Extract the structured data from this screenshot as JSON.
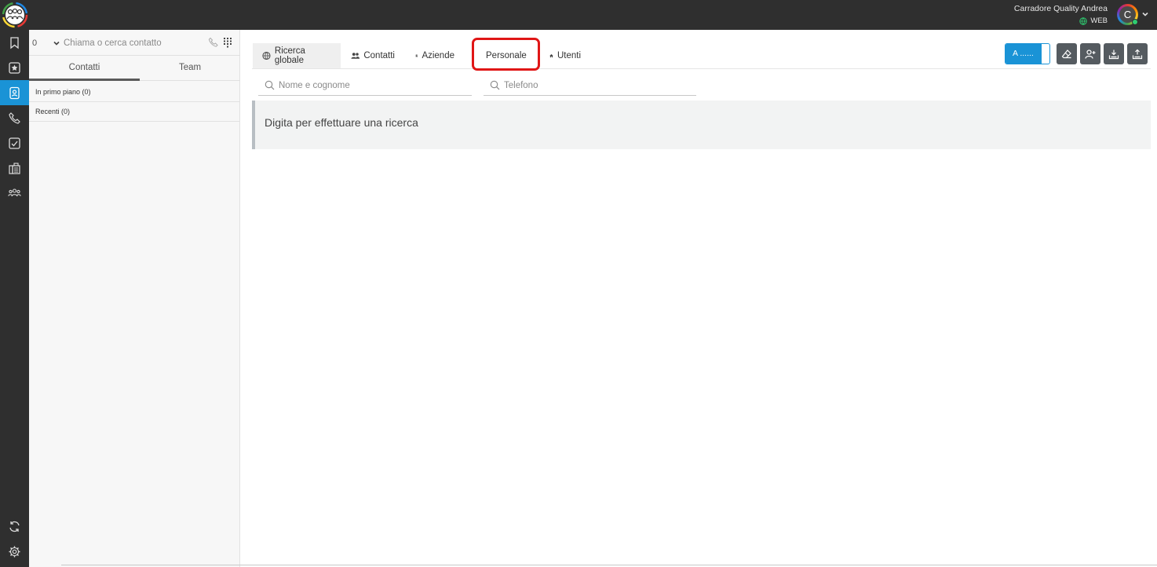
{
  "topbar": {
    "user_name": "Carradore Quality Andrea",
    "user_status": "WEB",
    "avatar_initial": "C",
    "accent_color": "#1a93d6"
  },
  "rail": {
    "items": [
      {
        "icon": "bookmark-icon",
        "active": false
      },
      {
        "icon": "favorites-icon",
        "active": false
      },
      {
        "icon": "contacts-icon",
        "active": true
      },
      {
        "icon": "phone-icon",
        "active": false
      },
      {
        "icon": "tasks-icon",
        "active": false
      },
      {
        "icon": "fax-icon",
        "active": false
      },
      {
        "icon": "team-icon",
        "active": false
      }
    ],
    "bottom_items": [
      {
        "icon": "refresh-icon"
      },
      {
        "icon": "gear-icon"
      }
    ]
  },
  "panel": {
    "line_number": "0",
    "search_placeholder": "Chiama o cerca contatto",
    "tabs": [
      "Contatti",
      "Team"
    ],
    "groups": [
      "In primo piano (0)",
      "Recenti (0)"
    ]
  },
  "main": {
    "tabs": [
      {
        "label": "Ricerca globale",
        "icon": "globe-icon",
        "active": true
      },
      {
        "label": "Contatti",
        "icon": "users-icon",
        "active": false
      },
      {
        "label": "Aziende",
        "icon": "building-icon",
        "active": false
      },
      {
        "label": "Personale",
        "icon": "person-icon",
        "active": false,
        "highlighted": true
      },
      {
        "label": "Utenti",
        "icon": "home-icon",
        "active": false
      }
    ],
    "toggle_label": "A ......",
    "actions": [
      "eraser-icon",
      "add-user-icon",
      "download-icon",
      "upload-icon"
    ],
    "name_placeholder": "Nome e cognome",
    "phone_placeholder": "Telefono",
    "notice": "Digita per effettuare una ricerca"
  }
}
